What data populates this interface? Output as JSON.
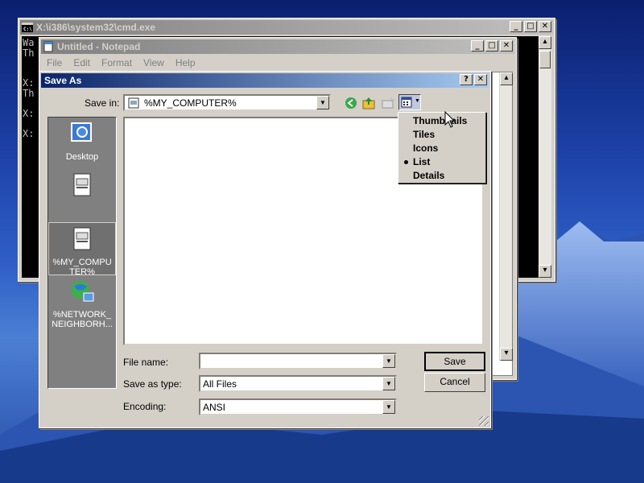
{
  "desktop": {
    "colors": {
      "sky_top": "#0b1f6e",
      "mountain_snow": "#7aa0e0"
    }
  },
  "cmd": {
    "title": "X:\\i386\\system32\\cmd.exe",
    "icon": "console-icon",
    "lines": [
      "Wa",
      "Th",
      "",
      "",
      "X:",
      "Th",
      "",
      "X:",
      "",
      "X:"
    ]
  },
  "notepad": {
    "title": "Untitled - Notepad",
    "menu": [
      "File",
      "Edit",
      "Format",
      "View",
      "Help"
    ]
  },
  "saveas": {
    "title": "Save As",
    "help_btn": "?",
    "close_btn": "✕",
    "save_in_label": "Save in:",
    "save_in_value": "%MY_COMPUTER%",
    "places": [
      {
        "label": "Desktop",
        "icon": "desktop-icon"
      },
      {
        "label": "",
        "icon": "document-icon"
      },
      {
        "label": "%MY_COMPUTER%",
        "icon": "computer-document-icon",
        "selected": true
      },
      {
        "label": "%NETWORK_NEIGHBORH...",
        "icon": "network-globe-icon"
      }
    ],
    "file_name_label": "File name:",
    "file_name_value": "",
    "save_type_label": "Save as type:",
    "save_type_value": "All Files",
    "encoding_label": "Encoding:",
    "encoding_value": "ANSI",
    "save_button": "Save",
    "cancel_button": "Cancel"
  },
  "view_menu": {
    "items": [
      "Thumbnails",
      "Tiles",
      "Icons",
      "List",
      "Details"
    ],
    "selected": "List"
  }
}
